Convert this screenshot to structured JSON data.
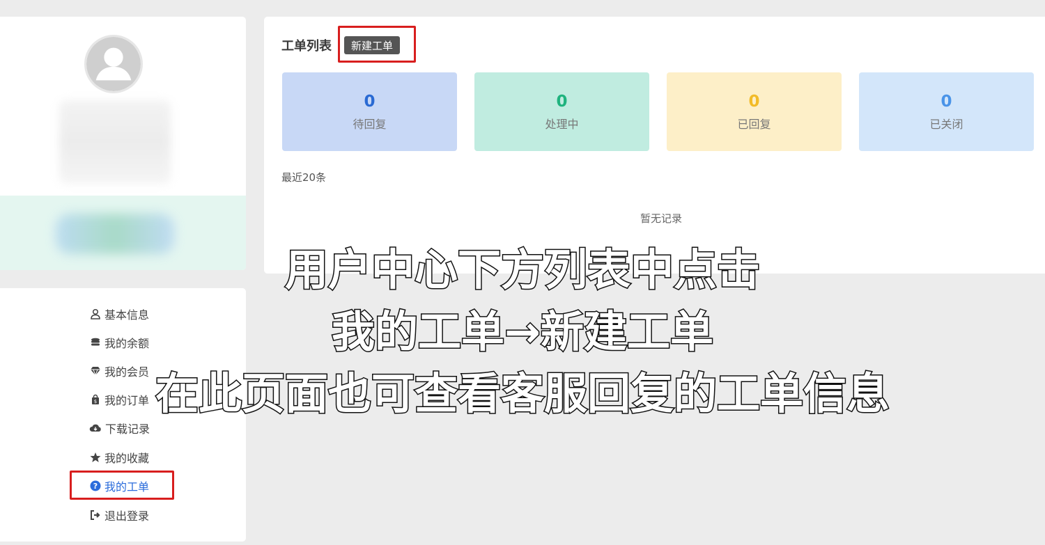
{
  "sidebar": {
    "menu": [
      {
        "label": "基本信息",
        "icon": "user-icon"
      },
      {
        "label": "我的余额",
        "icon": "coins-icon"
      },
      {
        "label": "我的会员",
        "icon": "diamond-icon"
      },
      {
        "label": "我的订单",
        "icon": "shopping-bag-icon"
      },
      {
        "label": "下载记录",
        "icon": "cloud-download-icon"
      },
      {
        "label": "我的收藏",
        "icon": "star-icon"
      },
      {
        "label": "我的工单",
        "icon": "question-circle-icon",
        "active": true
      },
      {
        "label": "退出登录",
        "icon": "sign-out-icon"
      }
    ]
  },
  "main": {
    "title": "工单列表",
    "new_button": "新建工单",
    "stats": [
      {
        "value": "0",
        "label": "待回复",
        "bg": "#c8d8f6",
        "color": "#2a6ad3"
      },
      {
        "value": "0",
        "label": "处理中",
        "bg": "#c0ece0",
        "color": "#1fb37e"
      },
      {
        "value": "0",
        "label": "已回复",
        "bg": "#fdefc8",
        "color": "#f2bb28"
      },
      {
        "value": "0",
        "label": "已关闭",
        "bg": "#d3e6fa",
        "color": "#4a94e8"
      }
    ],
    "recent_label": "最近20条",
    "empty_text": "暂无记录"
  },
  "caption": {
    "line1": "用户中心下方列表中点击",
    "line2": "我的工单→新建工单",
    "line3": "在此页面也可查看客服回复的工单信息"
  }
}
